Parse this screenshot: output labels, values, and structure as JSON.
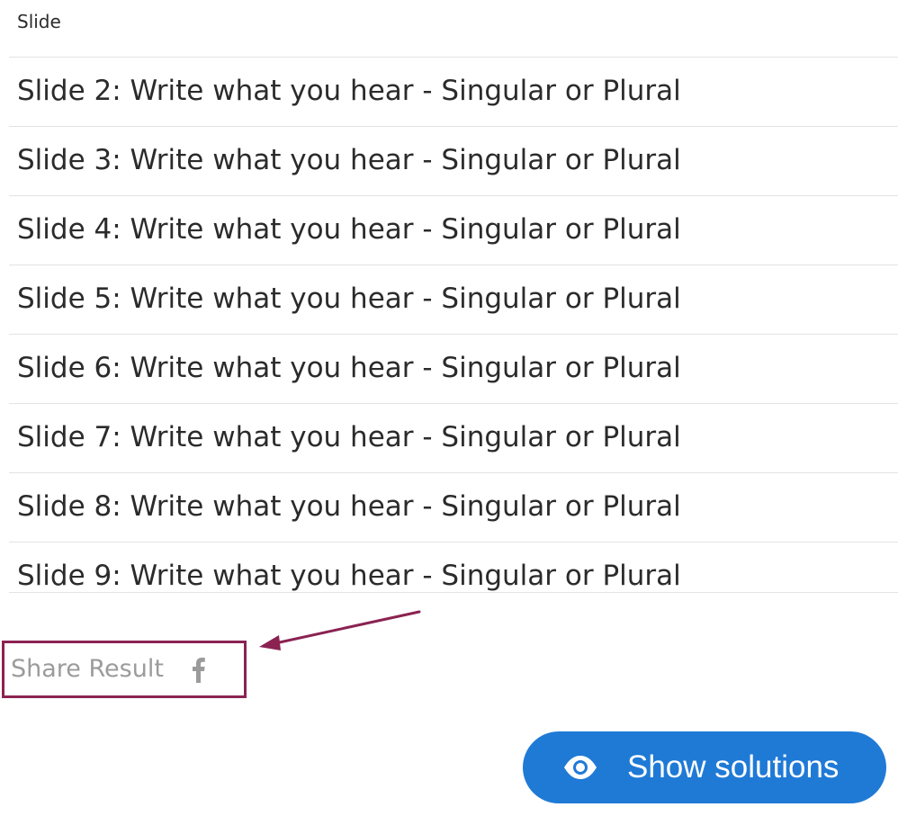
{
  "table": {
    "header": "Slide",
    "rows": [
      "Slide 2: Write what you hear - Singular or Plural",
      "Slide 3: Write what you hear - Singular or Plural",
      "Slide 4: Write what you hear - Singular or Plural",
      "Slide 5: Write what you hear - Singular or Plural",
      "Slide 6: Write what you hear - Singular or Plural",
      "Slide 7: Write what you hear - Singular or Plural",
      "Slide 8: Write what you hear - Singular or Plural",
      "Slide 9: Write what you hear - Singular or Plural"
    ]
  },
  "share": {
    "label": "Share Result",
    "icon": "facebook-icon",
    "highlight_color": "#8b2252"
  },
  "annotation": {
    "icon": "arrow-pointer-icon",
    "color": "#8b2252"
  },
  "solutions_button": {
    "label": "Show solutions",
    "icon": "eye-icon",
    "color": "#1f7ad6"
  }
}
